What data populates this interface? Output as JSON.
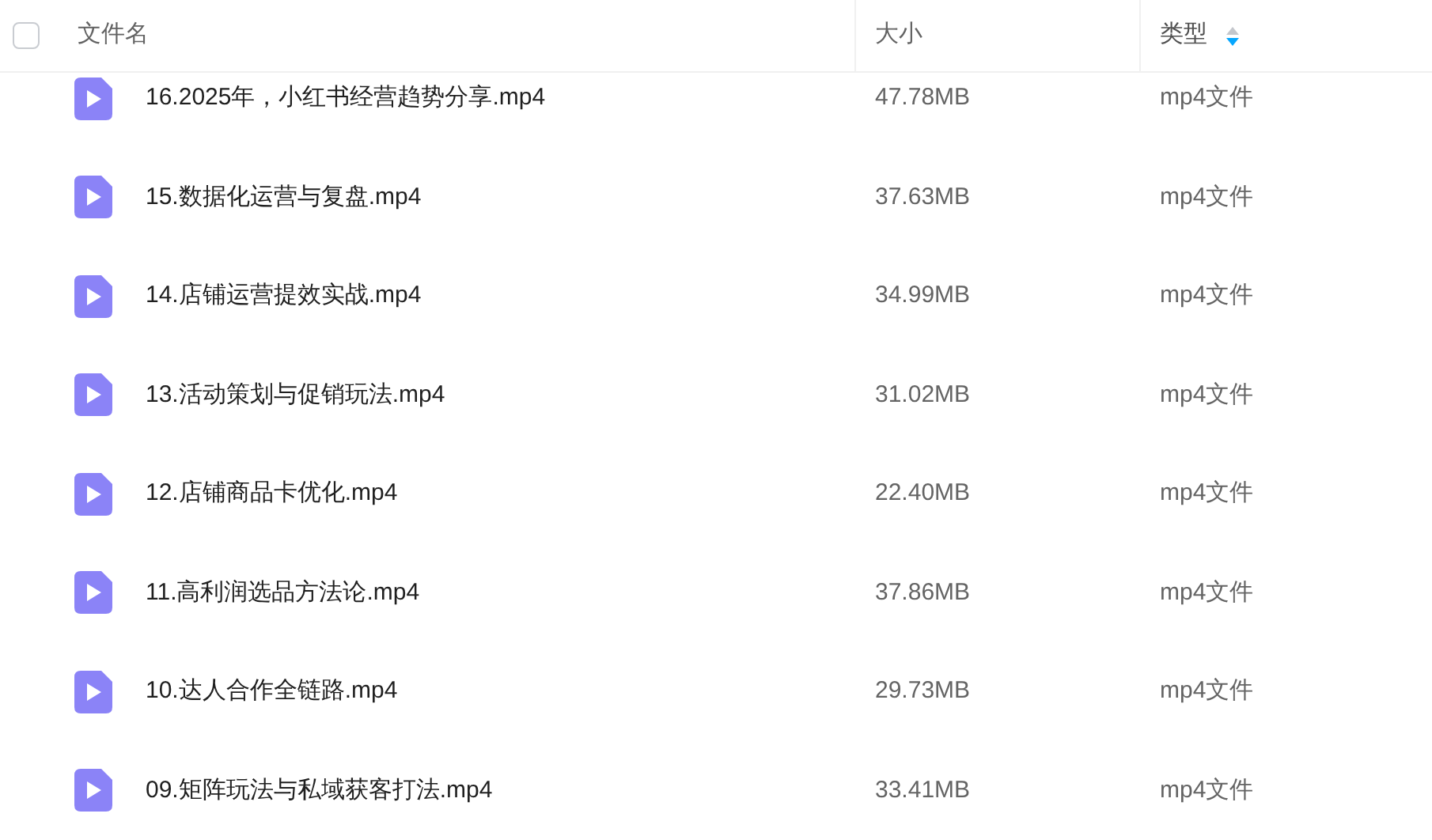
{
  "header": {
    "select_all": {
      "checked": false
    },
    "columns": [
      {
        "label": "文件名",
        "sorted": false
      },
      {
        "label": "大小",
        "sorted": false
      },
      {
        "label": "类型",
        "sorted": true
      }
    ]
  },
  "files": [
    {
      "name": "16.2025年，小红书经营趋势分享.mp4",
      "size": "47.78MB",
      "type": "mp4文件"
    },
    {
      "name": "15.数据化运营与复盘.mp4",
      "size": "37.63MB",
      "type": "mp4文件"
    },
    {
      "name": "14.店铺运营提效实战.mp4",
      "size": "34.99MB",
      "type": "mp4文件"
    },
    {
      "name": "13.活动策划与促销玩法.mp4",
      "size": "31.02MB",
      "type": "mp4文件"
    },
    {
      "name": "12.店铺商品卡优化.mp4",
      "size": "22.40MB",
      "type": "mp4文件"
    },
    {
      "name": "11.高利润选品方法论.mp4",
      "size": "37.86MB",
      "type": "mp4文件"
    },
    {
      "name": "10.达人合作全链路.mp4",
      "size": "29.73MB",
      "type": "mp4文件"
    },
    {
      "name": "09.矩阵玩法与私域获客打法.mp4",
      "size": "33.41MB",
      "type": "mp4文件"
    }
  ]
}
